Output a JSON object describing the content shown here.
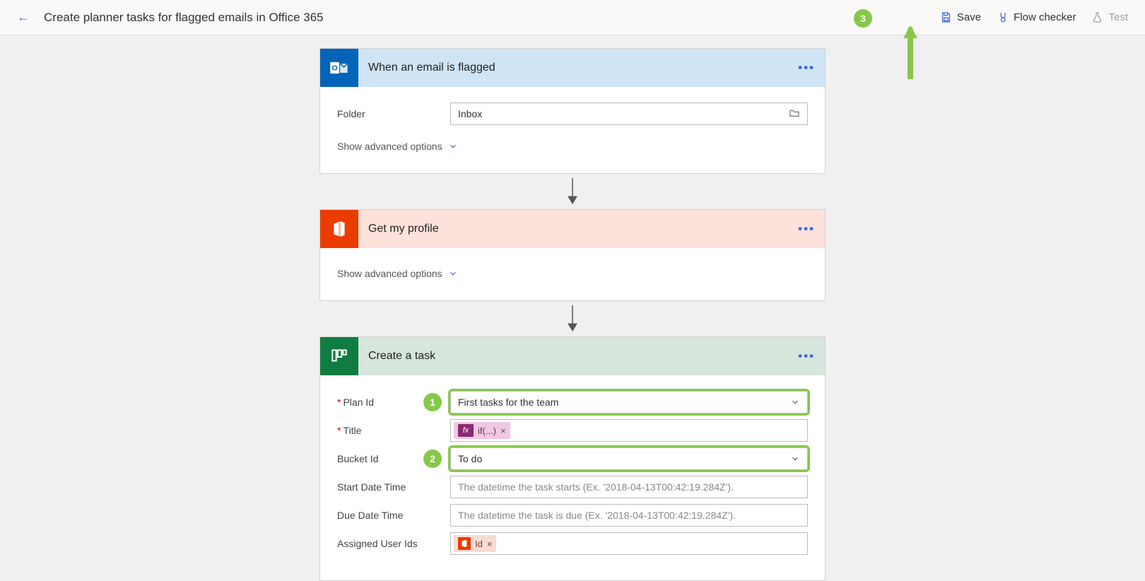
{
  "header": {
    "title": "Create planner tasks for flagged emails in Office 365",
    "save": "Save",
    "flow_checker": "Flow checker",
    "test": "Test"
  },
  "steps": {
    "email": {
      "title": "When an email is flagged",
      "folder_label": "Folder",
      "folder_value": "Inbox",
      "advanced": "Show advanced options"
    },
    "profile": {
      "title": "Get my profile",
      "advanced": "Show advanced options"
    },
    "task": {
      "title": "Create a task",
      "plan_label": "Plan Id",
      "plan_value": "First tasks for the team",
      "title_label": "Title",
      "title_token": "if(...)",
      "bucket_label": "Bucket Id",
      "bucket_value": "To do",
      "start_label": "Start Date Time",
      "start_placeholder": "The datetime the task starts (Ex. '2018-04-13T00:42:19.284Z').",
      "due_label": "Due Date Time",
      "due_placeholder": "The datetime the task is due (Ex. '2018-04-13T00:42:19.284Z').",
      "assigned_label": "Assigned User Ids",
      "assigned_token": "Id"
    }
  },
  "callouts": {
    "one": "1",
    "two": "2",
    "three": "3"
  }
}
